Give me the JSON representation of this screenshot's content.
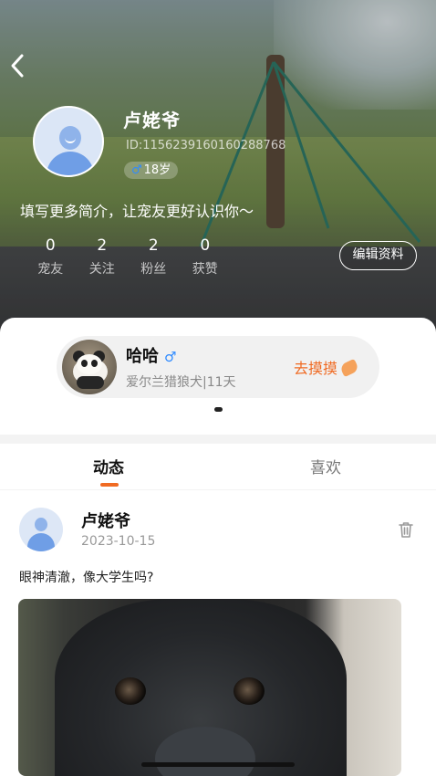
{
  "header": {
    "user_name": "卢姥爷",
    "user_id": "ID:11562391601602887​68",
    "gender_symbol": "♂",
    "age": "18岁",
    "bio": "填写更多简介，让宠友更好认识你～",
    "stats": [
      {
        "value": "0",
        "label": "宠友"
      },
      {
        "value": "2",
        "label": "关注"
      },
      {
        "value": "2",
        "label": "粉丝"
      },
      {
        "value": "0",
        "label": "获赞"
      }
    ],
    "edit_label": "编辑资料"
  },
  "pet": {
    "name": "哈哈",
    "gender_symbol": "♂",
    "info": "爱尔兰猎狼犬|11天",
    "action_label": "去摸摸"
  },
  "tabs": [
    {
      "label": "动态",
      "active": true
    },
    {
      "label": "喜欢",
      "active": false
    }
  ],
  "post": {
    "author": "卢姥爷",
    "date": "2023-10-15",
    "text": "眼神清澈，像大学生吗?"
  },
  "colors": {
    "accent": "#f06a22",
    "male_blue": "#2f8bff"
  }
}
